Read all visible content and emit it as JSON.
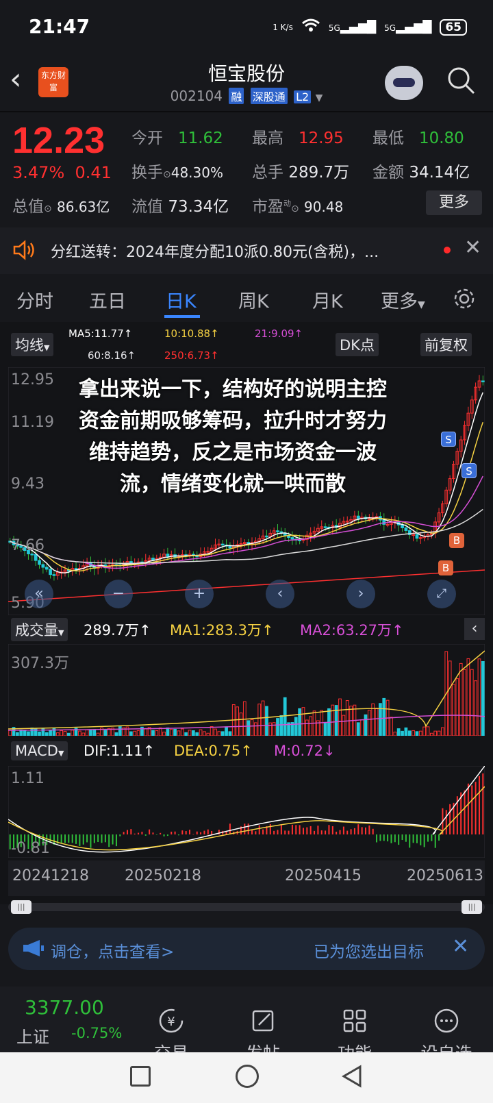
{
  "status_bar": {
    "time": "21:47",
    "net_speed": "1 K/s",
    "signal1": "5G",
    "signal2": "5G",
    "battery": "65"
  },
  "header": {
    "logo_text": "东方财富",
    "stock_name": "恒宝股份",
    "stock_code": "002104",
    "tags": [
      "融",
      "深股通",
      "L2"
    ]
  },
  "quote": {
    "price": "12.23",
    "change_pct": "3.47%",
    "change_amt": "0.41",
    "open_label": "今开",
    "open": "11.62",
    "high_label": "最高",
    "high": "12.95",
    "low_label": "最低",
    "low": "10.80",
    "turnover_label": "换手",
    "turnover": "48.30%",
    "volume_label": "总手",
    "volume": "289.7万",
    "amount_label": "金额",
    "amount": "34.14亿",
    "mcap_label": "总值",
    "mcap": "86.63亿",
    "float_label": "流值",
    "float_cap": "73.34亿",
    "pe_label": "市盈",
    "pe_sup": "动",
    "pe": "90.48",
    "more_label": "更多"
  },
  "notice": {
    "text": "分红送转：2024年度分配10派0.80元(含税)，..."
  },
  "tabs": [
    "分时",
    "五日",
    "日K",
    "周K",
    "月K",
    "更多"
  ],
  "active_tab": "日K",
  "kline_toolbar": {
    "indicator": "均线",
    "ma5": "MA5:11.77↑",
    "ma10": "10:10.88↑",
    "ma21": "21:9.09↑",
    "ma60": "60:8.16↑",
    "ma250": "250:6.73↑",
    "dk_label": "DK点",
    "adjust_label": "前复权"
  },
  "kline_axis": {
    "y_labels": [
      "12.95",
      "11.19",
      "9.43",
      "7.66",
      "5.90"
    ]
  },
  "overlay_text": [
    "拿出来说一下，结构好的说明主控",
    "资金前期吸够筹码，拉升时才努力",
    "维持趋势，反之是市场资金一波",
    "流，情绪变化就一哄而散"
  ],
  "volume_panel": {
    "indicator": "成交量",
    "vol": "289.7万↑",
    "ma1": "MA1:283.3万↑",
    "ma2": "MA2:63.27万↑",
    "max_label": "307.3万"
  },
  "macd_panel": {
    "indicator": "MACD",
    "dif": "DIF:1.11↑",
    "dea": "DEA:0.75↑",
    "m": "M:0.72↓",
    "top_label": "1.11",
    "bottom_label": "-0.81"
  },
  "x_axis": [
    "20241218",
    "20250218",
    "20250415",
    "20250613"
  ],
  "markers": [
    "S",
    "S",
    "B",
    "B"
  ],
  "ad_bar": {
    "left": "调仓，点击查看>",
    "right": "已为您选出目标"
  },
  "bottom_nav": {
    "index_value": "3377.00",
    "index_name": "上证",
    "index_change": "-0.75%",
    "items": [
      "交易",
      "发帖",
      "功能",
      "设自选"
    ]
  },
  "colors": {
    "up": "#ff3030",
    "down": "#2fbf3a",
    "accent": "#3a86ff",
    "ma5": "#ffffff",
    "ma10": "#f5d142",
    "ma21": "#d64fd6",
    "ma250": "#ff3030"
  }
}
